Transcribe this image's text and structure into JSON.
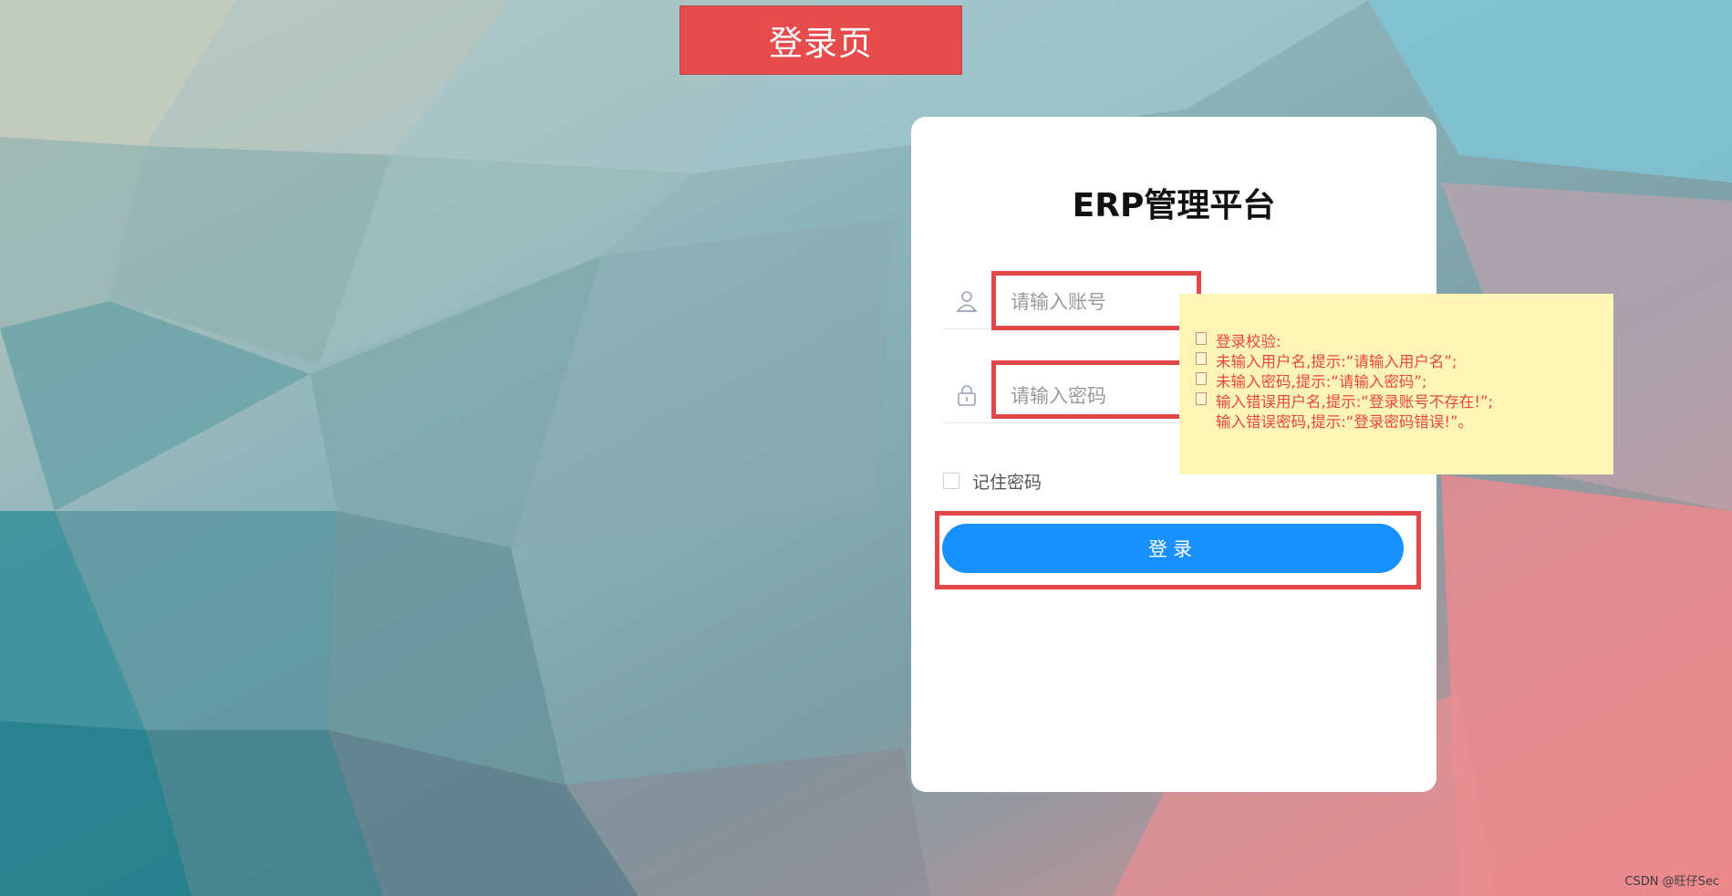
{
  "banner": {
    "text": "登录页"
  },
  "login": {
    "title": "ERP管理平台",
    "username_placeholder": "请输入账号",
    "password_placeholder": "请输入密码",
    "remember_label": "记住密码",
    "submit_label": "登录"
  },
  "note": {
    "lines": [
      "登录校验:",
      "未输入用户名,提示:“请输入用户名”;",
      "未输入密码,提示:“请输入密码”;",
      "输入错误用户名,提示:“登录账号不存在!”;",
      "输入错误密码,提示:“登录密码错误!”。"
    ]
  },
  "watermark": "CSDN @旺仔Sec",
  "icons": {
    "username": "user-icon",
    "password": "lock-icon"
  },
  "colors": {
    "banner_bg": "#e74c4c",
    "highlight": "#e04747",
    "button": "#1890ff",
    "note_bg": "#fdf5b5",
    "note_text": "#e8473f"
  }
}
